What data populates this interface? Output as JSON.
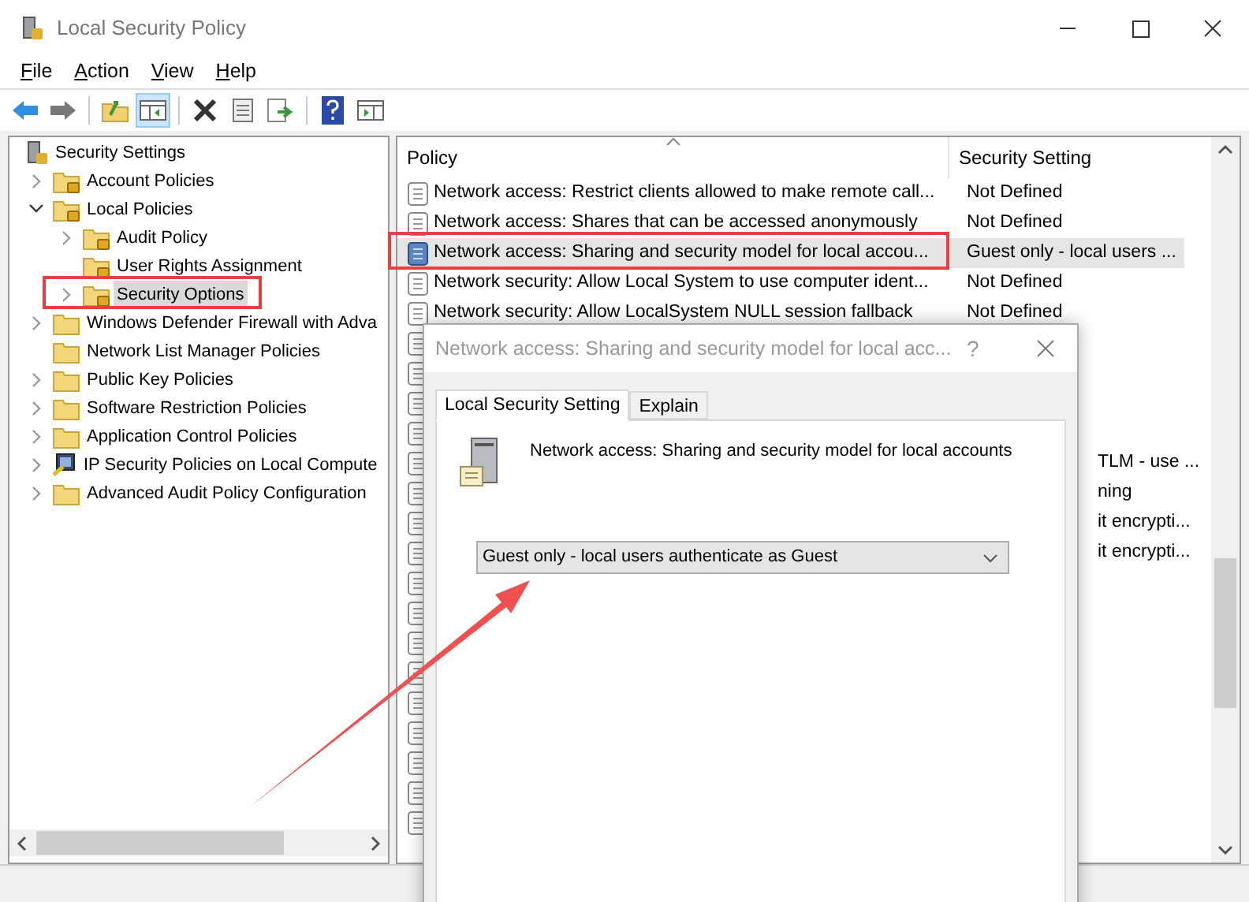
{
  "window": {
    "title": "Local Security Policy"
  },
  "menu": [
    "File",
    "Action",
    "View",
    "Help"
  ],
  "tree": {
    "label": "Security Settings",
    "kind": "root",
    "selected": false,
    "children": [
      {
        "label": "Account Policies",
        "kind": "locked",
        "selected": false,
        "expanded": false
      },
      {
        "label": "Local Policies",
        "kind": "locked",
        "selected": false,
        "expanded": true,
        "children": [
          {
            "label": "Audit Policy",
            "kind": "locked",
            "selected": false,
            "expanded": false
          },
          {
            "label": "User Rights Assignment",
            "kind": "locked",
            "selected": false
          },
          {
            "label": "Security Options",
            "kind": "locked",
            "selected": true,
            "expanded": false
          }
        ]
      },
      {
        "label": "Windows Defender Firewall with Adva",
        "kind": "folder",
        "selected": false,
        "expanded": false
      },
      {
        "label": "Network List Manager Policies",
        "kind": "folder",
        "selected": false
      },
      {
        "label": "Public Key Policies",
        "kind": "folder",
        "selected": false,
        "expanded": false
      },
      {
        "label": "Software Restriction Policies",
        "kind": "folder",
        "selected": false,
        "expanded": false
      },
      {
        "label": "Application Control Policies",
        "kind": "folder",
        "selected": false,
        "expanded": false
      },
      {
        "label": "IP Security Policies on Local Compute",
        "kind": "computer",
        "selected": false,
        "expanded": false
      },
      {
        "label": "Advanced Audit Policy Configuration",
        "kind": "folder",
        "selected": false,
        "expanded": false
      }
    ]
  },
  "list": {
    "columns": [
      "Policy",
      "Security Setting"
    ],
    "rows": [
      {
        "policy": "Network access: Restrict clients allowed to make remote call...",
        "setting": "Not Defined",
        "selected": false
      },
      {
        "policy": "Network access: Shares that can be accessed anonymously",
        "setting": "Not Defined",
        "selected": false
      },
      {
        "policy": "Network access: Sharing and security model for local accou...",
        "setting": "Guest only - local users ...",
        "selected": true
      },
      {
        "policy": "Network security: Allow Local System to use computer ident...",
        "setting": "Not Defined",
        "selected": false
      },
      {
        "policy": "Network security: Allow LocalSystem NULL session fallback",
        "setting": "Not Defined",
        "selected": false
      },
      {
        "selected": false
      },
      {
        "selected": false
      },
      {
        "selected": false
      },
      {
        "selected": false
      },
      {
        "setting_tail": "TLM - use ...",
        "selected": false
      },
      {
        "setting_tail": "ning",
        "selected": false
      },
      {
        "setting_tail": "it encrypti...",
        "selected": false
      },
      {
        "setting_tail": "it encrypti...",
        "selected": false
      },
      {
        "selected": false
      },
      {
        "selected": false
      },
      {
        "selected": false
      },
      {
        "selected": false
      },
      {
        "selected": false
      },
      {
        "selected": false
      },
      {
        "selected": false
      },
      {
        "selected": false
      },
      {
        "selected": false
      }
    ]
  },
  "dialog": {
    "title": "Network access: Sharing and security model for local acc...",
    "help": "?",
    "tabs": [
      {
        "label": "Local Security Setting",
        "selected": true
      },
      {
        "label": "Explain",
        "selected": false
      }
    ],
    "description": "Network access: Sharing and security model for local accounts",
    "dropdown": {
      "value": "Guest only - local users authenticate as Guest"
    }
  }
}
